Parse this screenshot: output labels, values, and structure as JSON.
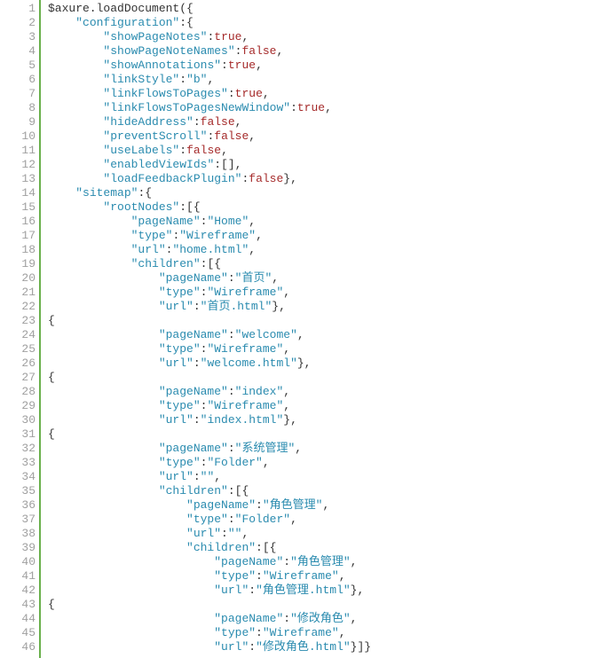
{
  "lines": [
    {
      "n": 1,
      "indent": 0,
      "tokens": [
        [
          "p",
          "$axure.loadDocument({"
        ]
      ]
    },
    {
      "n": 2,
      "indent": 1,
      "tokens": [
        [
          "s",
          "\"configuration\""
        ],
        [
          "p",
          ":{"
        ]
      ]
    },
    {
      "n": 3,
      "indent": 2,
      "tokens": [
        [
          "s",
          "\"showPageNotes\""
        ],
        [
          "p",
          ":"
        ],
        [
          "b",
          "true"
        ],
        [
          "p",
          ","
        ]
      ]
    },
    {
      "n": 4,
      "indent": 2,
      "tokens": [
        [
          "s",
          "\"showPageNoteNames\""
        ],
        [
          "p",
          ":"
        ],
        [
          "b",
          "false"
        ],
        [
          "p",
          ","
        ]
      ]
    },
    {
      "n": 5,
      "indent": 2,
      "tokens": [
        [
          "s",
          "\"showAnnotations\""
        ],
        [
          "p",
          ":"
        ],
        [
          "b",
          "true"
        ],
        [
          "p",
          ","
        ]
      ]
    },
    {
      "n": 6,
      "indent": 2,
      "tokens": [
        [
          "s",
          "\"linkStyle\""
        ],
        [
          "p",
          ":"
        ],
        [
          "s",
          "\"b\""
        ],
        [
          "p",
          ","
        ]
      ]
    },
    {
      "n": 7,
      "indent": 2,
      "tokens": [
        [
          "s",
          "\"linkFlowsToPages\""
        ],
        [
          "p",
          ":"
        ],
        [
          "b",
          "true"
        ],
        [
          "p",
          ","
        ]
      ]
    },
    {
      "n": 8,
      "indent": 2,
      "tokens": [
        [
          "s",
          "\"linkFlowsToPagesNewWindow\""
        ],
        [
          "p",
          ":"
        ],
        [
          "b",
          "true"
        ],
        [
          "p",
          ","
        ]
      ]
    },
    {
      "n": 9,
      "indent": 2,
      "tokens": [
        [
          "s",
          "\"hideAddress\""
        ],
        [
          "p",
          ":"
        ],
        [
          "b",
          "false"
        ],
        [
          "p",
          ","
        ]
      ]
    },
    {
      "n": 10,
      "indent": 2,
      "tokens": [
        [
          "s",
          "\"preventScroll\""
        ],
        [
          "p",
          ":"
        ],
        [
          "b",
          "false"
        ],
        [
          "p",
          ","
        ]
      ]
    },
    {
      "n": 11,
      "indent": 2,
      "tokens": [
        [
          "s",
          "\"useLabels\""
        ],
        [
          "p",
          ":"
        ],
        [
          "b",
          "false"
        ],
        [
          "p",
          ","
        ]
      ]
    },
    {
      "n": 12,
      "indent": 2,
      "tokens": [
        [
          "s",
          "\"enabledViewIds\""
        ],
        [
          "p",
          ":[],"
        ]
      ]
    },
    {
      "n": 13,
      "indent": 2,
      "tokens": [
        [
          "s",
          "\"loadFeedbackPlugin\""
        ],
        [
          "p",
          ":"
        ],
        [
          "b",
          "false"
        ],
        [
          "p",
          "},"
        ]
      ]
    },
    {
      "n": 14,
      "indent": 1,
      "tokens": [
        [
          "s",
          "\"sitemap\""
        ],
        [
          "p",
          ":{"
        ]
      ]
    },
    {
      "n": 15,
      "indent": 2,
      "tokens": [
        [
          "s",
          "\"rootNodes\""
        ],
        [
          "p",
          ":[{"
        ]
      ]
    },
    {
      "n": 16,
      "indent": 3,
      "tokens": [
        [
          "s",
          "\"pageName\""
        ],
        [
          "p",
          ":"
        ],
        [
          "s",
          "\"Home\""
        ],
        [
          "p",
          ","
        ]
      ]
    },
    {
      "n": 17,
      "indent": 3,
      "tokens": [
        [
          "s",
          "\"type\""
        ],
        [
          "p",
          ":"
        ],
        [
          "s",
          "\"Wireframe\""
        ],
        [
          "p",
          ","
        ]
      ]
    },
    {
      "n": 18,
      "indent": 3,
      "tokens": [
        [
          "s",
          "\"url\""
        ],
        [
          "p",
          ":"
        ],
        [
          "s",
          "\"home.html\""
        ],
        [
          "p",
          ","
        ]
      ]
    },
    {
      "n": 19,
      "indent": 3,
      "tokens": [
        [
          "s",
          "\"children\""
        ],
        [
          "p",
          ":[{"
        ]
      ]
    },
    {
      "n": 20,
      "indent": 4,
      "tokens": [
        [
          "s",
          "\"pageName\""
        ],
        [
          "p",
          ":"
        ],
        [
          "s",
          "\"首页\""
        ],
        [
          "p",
          ","
        ]
      ]
    },
    {
      "n": 21,
      "indent": 4,
      "tokens": [
        [
          "s",
          "\"type\""
        ],
        [
          "p",
          ":"
        ],
        [
          "s",
          "\"Wireframe\""
        ],
        [
          "p",
          ","
        ]
      ]
    },
    {
      "n": 22,
      "indent": 4,
      "tokens": [
        [
          "s",
          "\"url\""
        ],
        [
          "p",
          ":"
        ],
        [
          "s",
          "\"首页.html\""
        ],
        [
          "p",
          "},"
        ]
      ]
    },
    {
      "n": 23,
      "indent": 0,
      "tokens": [
        [
          "p",
          "{"
        ]
      ]
    },
    {
      "n": 24,
      "indent": 4,
      "tokens": [
        [
          "s",
          "\"pageName\""
        ],
        [
          "p",
          ":"
        ],
        [
          "s",
          "\"welcome\""
        ],
        [
          "p",
          ","
        ]
      ]
    },
    {
      "n": 25,
      "indent": 4,
      "tokens": [
        [
          "s",
          "\"type\""
        ],
        [
          "p",
          ":"
        ],
        [
          "s",
          "\"Wireframe\""
        ],
        [
          "p",
          ","
        ]
      ]
    },
    {
      "n": 26,
      "indent": 4,
      "tokens": [
        [
          "s",
          "\"url\""
        ],
        [
          "p",
          ":"
        ],
        [
          "s",
          "\"welcome.html\""
        ],
        [
          "p",
          "},"
        ]
      ]
    },
    {
      "n": 27,
      "indent": 0,
      "tokens": [
        [
          "p",
          "{"
        ]
      ]
    },
    {
      "n": 28,
      "indent": 4,
      "tokens": [
        [
          "s",
          "\"pageName\""
        ],
        [
          "p",
          ":"
        ],
        [
          "s",
          "\"index\""
        ],
        [
          "p",
          ","
        ]
      ]
    },
    {
      "n": 29,
      "indent": 4,
      "tokens": [
        [
          "s",
          "\"type\""
        ],
        [
          "p",
          ":"
        ],
        [
          "s",
          "\"Wireframe\""
        ],
        [
          "p",
          ","
        ]
      ]
    },
    {
      "n": 30,
      "indent": 4,
      "tokens": [
        [
          "s",
          "\"url\""
        ],
        [
          "p",
          ":"
        ],
        [
          "s",
          "\"index.html\""
        ],
        [
          "p",
          "},"
        ]
      ]
    },
    {
      "n": 31,
      "indent": 0,
      "tokens": [
        [
          "p",
          "{"
        ]
      ]
    },
    {
      "n": 32,
      "indent": 4,
      "tokens": [
        [
          "s",
          "\"pageName\""
        ],
        [
          "p",
          ":"
        ],
        [
          "s",
          "\"系统管理\""
        ],
        [
          "p",
          ","
        ]
      ]
    },
    {
      "n": 33,
      "indent": 4,
      "tokens": [
        [
          "s",
          "\"type\""
        ],
        [
          "p",
          ":"
        ],
        [
          "s",
          "\"Folder\""
        ],
        [
          "p",
          ","
        ]
      ]
    },
    {
      "n": 34,
      "indent": 4,
      "tokens": [
        [
          "s",
          "\"url\""
        ],
        [
          "p",
          ":"
        ],
        [
          "s",
          "\"\""
        ],
        [
          "p",
          ","
        ]
      ]
    },
    {
      "n": 35,
      "indent": 4,
      "tokens": [
        [
          "s",
          "\"children\""
        ],
        [
          "p",
          ":[{"
        ]
      ]
    },
    {
      "n": 36,
      "indent": 5,
      "tokens": [
        [
          "s",
          "\"pageName\""
        ],
        [
          "p",
          ":"
        ],
        [
          "s",
          "\"角色管理\""
        ],
        [
          "p",
          ","
        ]
      ]
    },
    {
      "n": 37,
      "indent": 5,
      "tokens": [
        [
          "s",
          "\"type\""
        ],
        [
          "p",
          ":"
        ],
        [
          "s",
          "\"Folder\""
        ],
        [
          "p",
          ","
        ]
      ]
    },
    {
      "n": 38,
      "indent": 5,
      "tokens": [
        [
          "s",
          "\"url\""
        ],
        [
          "p",
          ":"
        ],
        [
          "s",
          "\"\""
        ],
        [
          "p",
          ","
        ]
      ]
    },
    {
      "n": 39,
      "indent": 5,
      "tokens": [
        [
          "s",
          "\"children\""
        ],
        [
          "p",
          ":[{"
        ]
      ]
    },
    {
      "n": 40,
      "indent": 6,
      "tokens": [
        [
          "s",
          "\"pageName\""
        ],
        [
          "p",
          ":"
        ],
        [
          "s",
          "\"角色管理\""
        ],
        [
          "p",
          ","
        ]
      ]
    },
    {
      "n": 41,
      "indent": 6,
      "tokens": [
        [
          "s",
          "\"type\""
        ],
        [
          "p",
          ":"
        ],
        [
          "s",
          "\"Wireframe\""
        ],
        [
          "p",
          ","
        ]
      ]
    },
    {
      "n": 42,
      "indent": 6,
      "tokens": [
        [
          "s",
          "\"url\""
        ],
        [
          "p",
          ":"
        ],
        [
          "s",
          "\"角色管理.html\""
        ],
        [
          "p",
          "},"
        ]
      ]
    },
    {
      "n": 43,
      "indent": 0,
      "tokens": [
        [
          "p",
          "{"
        ]
      ]
    },
    {
      "n": 44,
      "indent": 6,
      "tokens": [
        [
          "s",
          "\"pageName\""
        ],
        [
          "p",
          ":"
        ],
        [
          "s",
          "\"修改角色\""
        ],
        [
          "p",
          ","
        ]
      ]
    },
    {
      "n": 45,
      "indent": 6,
      "tokens": [
        [
          "s",
          "\"type\""
        ],
        [
          "p",
          ":"
        ],
        [
          "s",
          "\"Wireframe\""
        ],
        [
          "p",
          ","
        ]
      ]
    },
    {
      "n": 46,
      "indent": 6,
      "tokens": [
        [
          "s",
          "\"url\""
        ],
        [
          "p",
          ":"
        ],
        [
          "s",
          "\"修改角色.html\""
        ],
        [
          "p",
          "}]}"
        ]
      ]
    }
  ],
  "indent_unit": "    "
}
